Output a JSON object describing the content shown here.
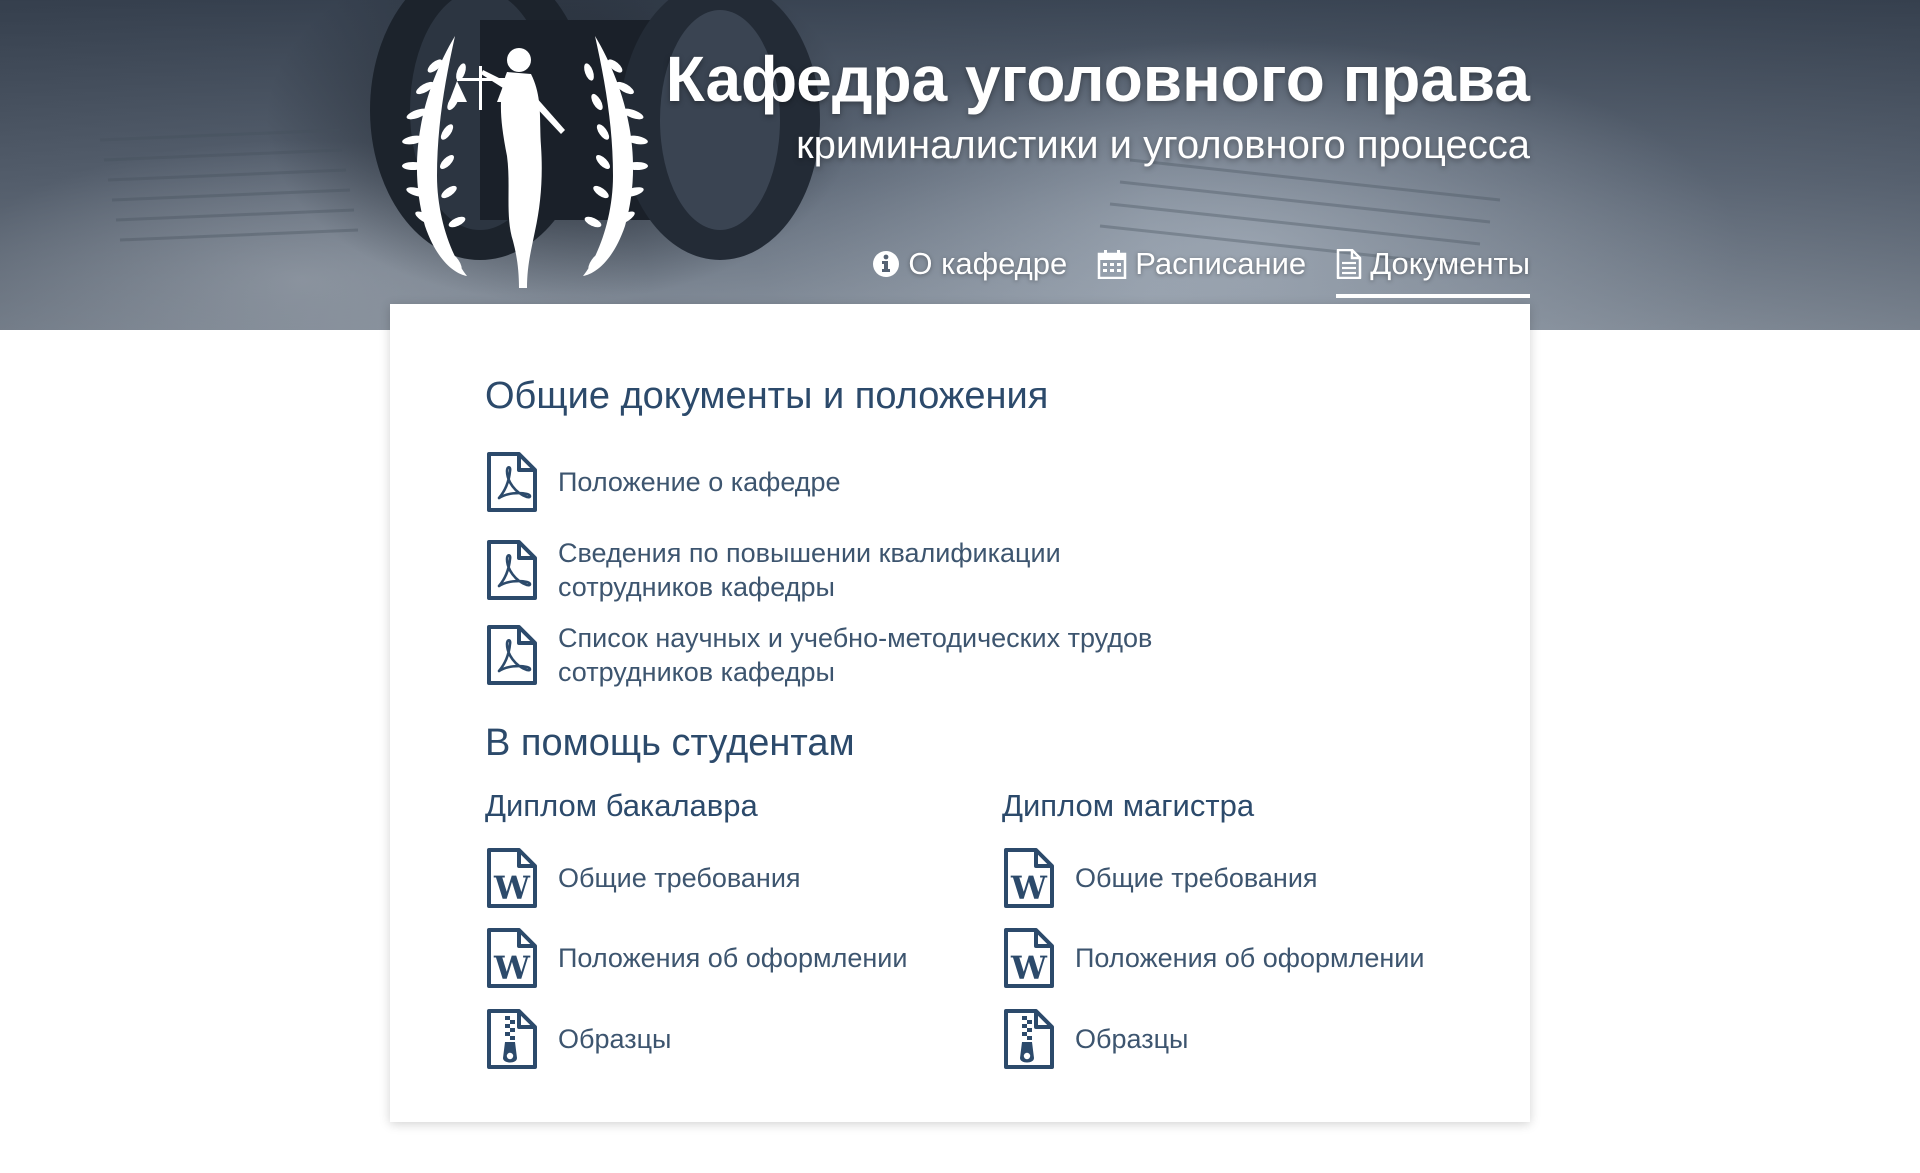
{
  "header": {
    "title": "Кафедра уголовного права",
    "subtitle": "криминалистики и уголовного процесса",
    "emblem_icon": "themis-laurel-emblem",
    "nav": [
      {
        "label": "О кафедре",
        "icon": "info-circle-icon",
        "active": false
      },
      {
        "label": "Расписание",
        "icon": "calendar-icon",
        "active": false
      },
      {
        "label": "Документы",
        "icon": "document-icon",
        "active": true
      }
    ]
  },
  "main": {
    "general": {
      "heading": "Общие документы и положения",
      "items": [
        {
          "line1": "Положение о кафедре",
          "line2": "",
          "icon": "pdf-file-icon"
        },
        {
          "line1": "Сведения по повышении квалификации",
          "line2": "сотрудников кафедры",
          "icon": "pdf-file-icon"
        },
        {
          "line1": "Список научных и учебно-методических трудов",
          "line2": "сотрудников кафедры",
          "icon": "pdf-file-icon"
        }
      ]
    },
    "students": {
      "heading": "В помощь студентам",
      "bachelor": {
        "heading": "Диплом бакалавра",
        "items": [
          {
            "label": "Общие требования",
            "icon": "word-file-icon"
          },
          {
            "label": "Положения об оформлении",
            "icon": "word-file-icon"
          },
          {
            "label": "Образцы",
            "icon": "zip-file-icon"
          }
        ]
      },
      "master": {
        "heading": "Диплом магистра",
        "items": [
          {
            "label": "Общие требования",
            "icon": "word-file-icon"
          },
          {
            "label": "Положения об оформлении",
            "icon": "word-file-icon"
          },
          {
            "label": "Образцы",
            "icon": "zip-file-icon"
          }
        ]
      }
    }
  },
  "colors": {
    "text": "#2c4a6b",
    "icon": "#2c4a6b",
    "header_text": "#ffffff"
  }
}
